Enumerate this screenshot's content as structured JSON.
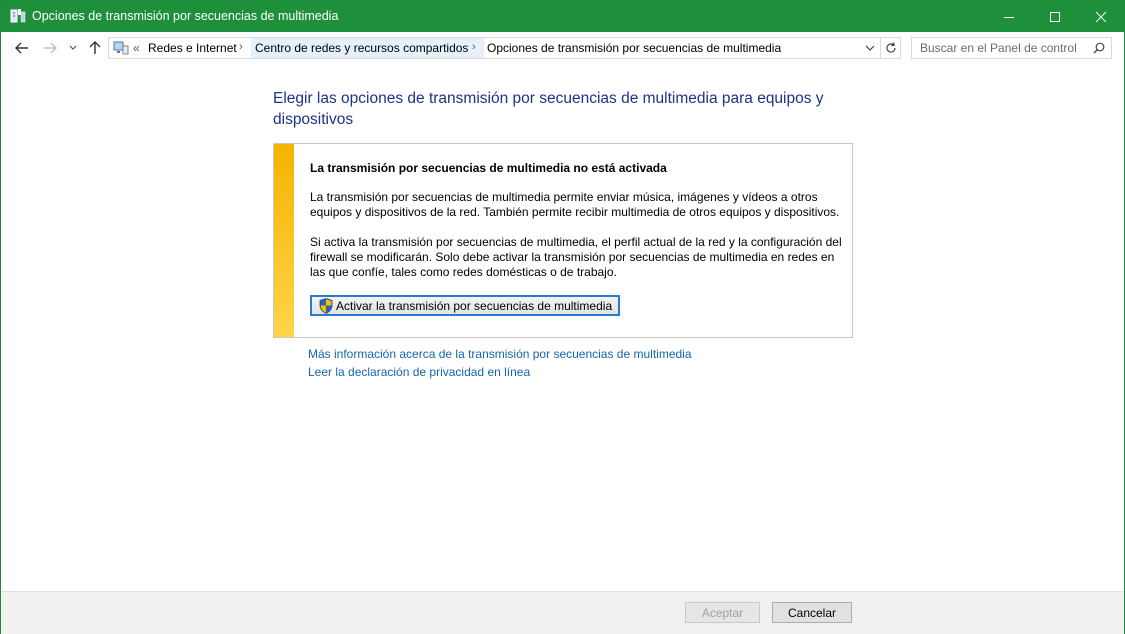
{
  "window": {
    "title": "Opciones de transmisión por secuencias de multimedia",
    "titlebar_color": "#1e8f3a"
  },
  "nav": {
    "overflow": "«",
    "breadcrumb": [
      "Redes e Internet",
      "Centro de redes y recursos compartidos",
      "Opciones de transmisión por secuencias de multimedia"
    ],
    "search_placeholder": "Buscar en el Panel de control"
  },
  "main": {
    "heading": "Elegir las opciones de transmisión por secuencias de multimedia para equipos y dispositivos",
    "panel": {
      "title": "La transmisión por secuencias de multimedia no está activada",
      "paragraph1": "La transmisión por secuencias de multimedia permite enviar música, imágenes y vídeos a otros equipos y dispositivos de la red. También permite recibir multimedia de otros equipos y dispositivos.",
      "paragraph2": "Si activa la transmisión por secuencias de multimedia, el perfil actual de la red y la configuración del firewall se modificarán. Solo debe activar la transmisión por secuencias de multimedia en redes en las que confíe, tales como redes domésticas o de trabajo.",
      "button_label": "Activar la transmisión por secuencias de multimedia",
      "accent_color": "#f5b300"
    },
    "links": [
      "Más información acerca de la transmisión por secuencias de multimedia",
      "Leer la declaración de privacidad en línea"
    ]
  },
  "footer": {
    "accept_label": "Aceptar",
    "cancel_label": "Cancelar"
  }
}
